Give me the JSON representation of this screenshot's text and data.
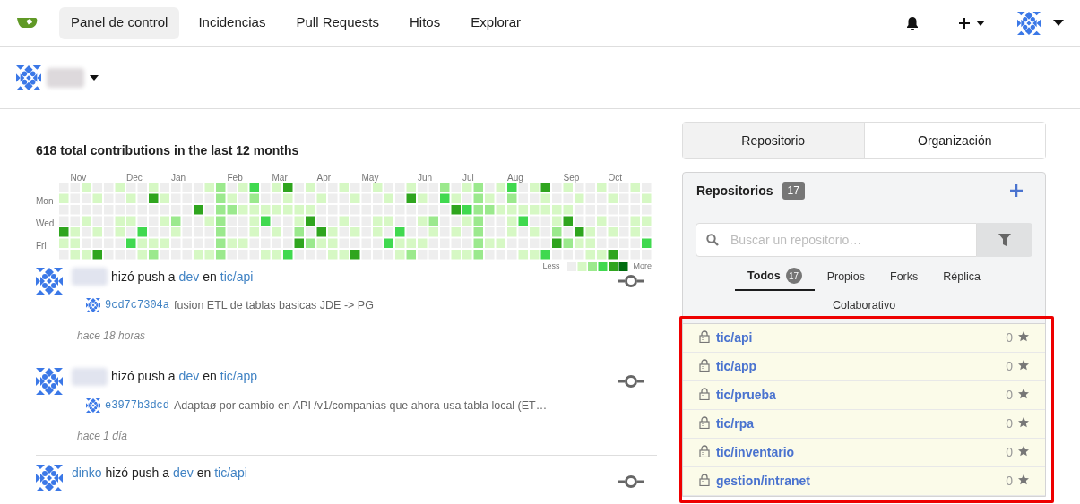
{
  "nav": {
    "items": [
      {
        "label": "Panel de control",
        "selected": true
      },
      {
        "label": "Incidencias",
        "selected": false
      },
      {
        "label": "Pull Requests",
        "selected": false
      },
      {
        "label": "Hitos",
        "selected": false
      },
      {
        "label": "Explorar",
        "selected": false
      }
    ]
  },
  "contributions": {
    "title": "618 total contributions in the last 12 months",
    "months": [
      "Nov",
      "Dec",
      "Jan",
      "Feb",
      "Mar",
      "Apr",
      "May",
      "Jun",
      "Jul",
      "Aug",
      "Sep",
      "Oct"
    ],
    "days": [
      "Mon",
      "Wed",
      "Fri"
    ],
    "legend": {
      "less": "Less",
      "more": "More"
    }
  },
  "feed": [
    {
      "action": "hizó push a",
      "branch": "dev",
      "connector": "en",
      "repo": "tic/api",
      "commits": [
        {
          "sha": "9cd7c7304a",
          "message": "fusion ETL de tablas basicas JDE -> PG"
        }
      ],
      "time": "hace 18 horas"
    },
    {
      "action": "hizó push a",
      "branch": "dev",
      "connector": "en",
      "repo": "tic/app",
      "commits": [
        {
          "sha": "e3977b3dcd",
          "message": "Adaptaø por cambio en API /v1/companias que ahora usa tabla local (ET…"
        }
      ],
      "time": "hace 1 día"
    },
    {
      "author": "dinko",
      "action": "hizó push a",
      "branch": "dev",
      "connector": "en",
      "repo": "tic/api"
    }
  ],
  "dashboard_tabs": [
    {
      "label": "Repositorio",
      "selected": true
    },
    {
      "label": "Organización",
      "selected": false
    }
  ],
  "repos": {
    "title": "Repositorios",
    "count": "17",
    "search": {
      "placeholder": "Buscar un repositorio…"
    },
    "filters": [
      {
        "label": "Todos",
        "count": "17",
        "selected": true
      },
      {
        "label": "Propios",
        "selected": false
      },
      {
        "label": "Forks",
        "selected": false
      },
      {
        "label": "Réplica",
        "selected": false
      },
      {
        "label": "Colaborativo",
        "selected": false
      }
    ],
    "items": [
      {
        "name": "tic/api",
        "star_count": "0",
        "private": true,
        "highlighted": true
      },
      {
        "name": "tic/app",
        "star_count": "0",
        "private": true,
        "highlighted": true
      },
      {
        "name": "tic/prueba",
        "star_count": "0",
        "private": true,
        "highlighted": true
      },
      {
        "name": "tic/rpa",
        "star_count": "0",
        "private": true,
        "highlighted": true
      },
      {
        "name": "tic/inventario",
        "star_count": "0",
        "private": true,
        "highlighted": true
      },
      {
        "name": "gestion/intranet",
        "star_count": "0",
        "private": true,
        "highlighted": true
      }
    ]
  }
}
